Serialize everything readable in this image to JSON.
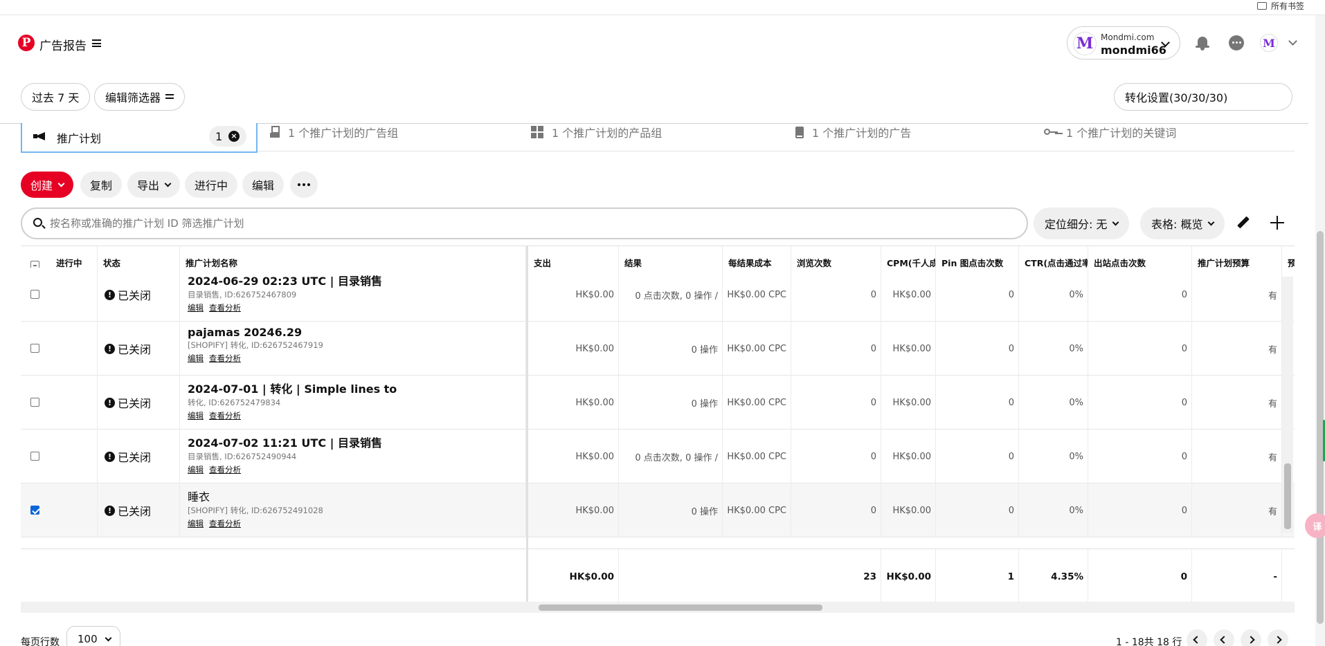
{
  "bookmarks": {
    "label": "所有书签"
  },
  "header": {
    "logo": "P",
    "title": "广告报告",
    "account": {
      "domain": "Mondmi.com",
      "username": "mondmi66",
      "avatar_letter": "M"
    }
  },
  "filters": {
    "date_range": "过去 7 天",
    "edit_filters": "编辑筛选器",
    "conversion_settings": "转化设置(30/30/30)"
  },
  "tabs": {
    "active": {
      "label": "推广计划",
      "count": "1",
      "clear": "×"
    },
    "others": [
      {
        "label": "1 个推广计划的广告组",
        "icon": "ad-group-icon"
      },
      {
        "label": "1 个推广计划的产品组",
        "icon": "grid-icon"
      },
      {
        "label": "1 个推广计划的广告",
        "icon": "ad-icon"
      },
      {
        "label": "1 个推广计划的关键词",
        "icon": "key-icon"
      }
    ]
  },
  "actions": {
    "create": "创建",
    "copy": "复制",
    "export": "导出",
    "active": "进行中",
    "edit": "编辑"
  },
  "search": {
    "placeholder": "按名称或准确的推广计划 ID 筛选推广计划"
  },
  "breakdown": {
    "label": "定位细分: 无"
  },
  "table_view": {
    "label": "表格: 概览"
  },
  "table": {
    "columns": [
      "进行中",
      "状态",
      "推广计划名称",
      "支出",
      "结果",
      "每结果成本",
      "浏览次数",
      "CPM(千人成本)",
      "Pin 图点击次数",
      "CTR(点击通过率)",
      "出站点击次数",
      "推广计划预算",
      "预"
    ],
    "rows": [
      {
        "checked": false,
        "status": "已关闭",
        "name": "2024-06-29 02:23 UTC | 目录销售",
        "sub": "目录销售, ID:626752467809",
        "edit": "编辑",
        "analysis": "查看分析",
        "spend": "HK$0.00",
        "result": "0 点击次数, 0 操作 /",
        "cpr": "HK$0.00 CPC",
        "impressions": "0",
        "cpm": "HK$0.00",
        "pin_clicks": "0",
        "ctr": "0%",
        "outbound": "0",
        "budget": "有"
      },
      {
        "checked": false,
        "status": "已关闭",
        "name": "pajamas 20246.29",
        "sub": "[SHOPIFY] 转化, ID:626752467919",
        "edit": "编辑",
        "analysis": "查看分析",
        "spend": "HK$0.00",
        "result": "0 操作",
        "cpr": "HK$0.00 CPC",
        "impressions": "0",
        "cpm": "HK$0.00",
        "pin_clicks": "0",
        "ctr": "0%",
        "outbound": "0",
        "budget": "有"
      },
      {
        "checked": false,
        "status": "已关闭",
        "name": "2024-07-01 | 转化 | Simple lines to",
        "sub": "转化, ID:626752479834",
        "edit": "编辑",
        "analysis": "查看分析",
        "spend": "HK$0.00",
        "result": "0 操作",
        "cpr": "HK$0.00 CPC",
        "impressions": "0",
        "cpm": "HK$0.00",
        "pin_clicks": "0",
        "ctr": "0%",
        "outbound": "0",
        "budget": "有"
      },
      {
        "checked": false,
        "status": "已关闭",
        "name": "2024-07-02 11:21 UTC | 目录销售",
        "sub": "目录销售, ID:626752490944",
        "edit": "编辑",
        "analysis": "查看分析",
        "spend": "HK$0.00",
        "result": "0 点击次数, 0 操作 /",
        "cpr": "HK$0.00 CPC",
        "impressions": "0",
        "cpm": "HK$0.00",
        "pin_clicks": "0",
        "ctr": "0%",
        "outbound": "0",
        "budget": "有"
      },
      {
        "checked": true,
        "status": "已关闭",
        "name": "睡衣",
        "sub": "[SHOPIFY] 转化, ID:626752491028",
        "edit": "编辑",
        "analysis": "查看分析",
        "spend": "HK$0.00",
        "result": "0 操作",
        "cpr": "HK$0.00 CPC",
        "impressions": "0",
        "cpm": "HK$0.00",
        "pin_clicks": "0",
        "ctr": "0%",
        "outbound": "0",
        "budget": "有"
      }
    ],
    "totals": {
      "spend": "HK$0.00",
      "impressions": "23",
      "cpm": "HK$0.00",
      "pin_clicks": "1",
      "ctr": "4.35%",
      "outbound": "0",
      "budget": "-"
    }
  },
  "footer": {
    "rows_per_page_label": "每页行数",
    "rows_per_page": "100",
    "page_info": "1 - 18共 18 行"
  },
  "translate": {
    "label": "译"
  },
  "colors": {
    "brand": "#e60023",
    "active_tab_border": "#74b5f0",
    "checkbox": "#0a66d8"
  }
}
